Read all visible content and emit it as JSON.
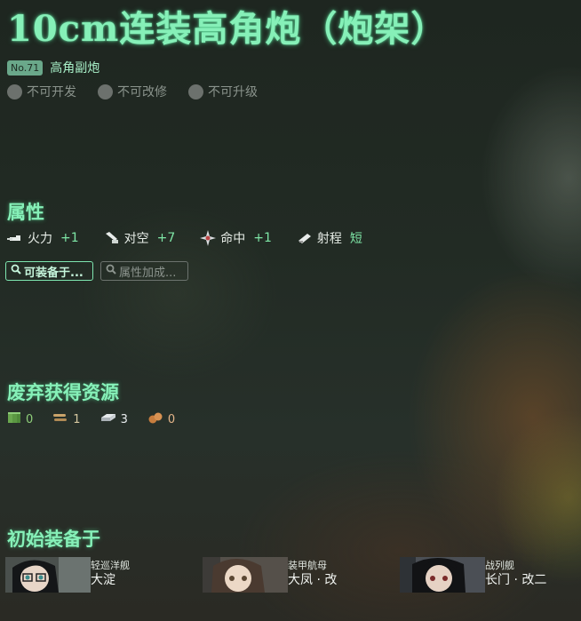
{
  "equipment": {
    "name": "10cm连装高角炮（炮架）",
    "number_badge": "No.71",
    "type": "高角副炮"
  },
  "flags": [
    {
      "label": "不可开发"
    },
    {
      "label": "不可改修"
    },
    {
      "label": "不可升级"
    }
  ],
  "stats_section": {
    "title": "属性",
    "items": [
      {
        "icon": "firepower-icon",
        "label": "火力",
        "value": "+1"
      },
      {
        "icon": "anti-air-icon",
        "label": "对空",
        "value": "+7"
      },
      {
        "icon": "accuracy-icon",
        "label": "命中",
        "value": "+1"
      },
      {
        "icon": "range-icon",
        "label": "射程",
        "value": "短"
      }
    ]
  },
  "buttons": {
    "equippable": "可装备于...",
    "bonus": "属性加成..."
  },
  "scrap_section": {
    "title": "废弃获得资源",
    "items": [
      {
        "icon": "fuel-icon",
        "value": "0"
      },
      {
        "icon": "ammo-icon",
        "value": "1"
      },
      {
        "icon": "steel-icon",
        "value": "3"
      },
      {
        "icon": "bauxite-icon",
        "value": "0"
      }
    ]
  },
  "initial_section": {
    "title": "初始装备于",
    "ships": [
      {
        "class": "轻巡洋舰",
        "name": "大淀"
      },
      {
        "class": "装甲航母",
        "name": "大凤 · 改"
      },
      {
        "class": "战列舰",
        "name": "长门 · 改二"
      }
    ]
  },
  "colors": {
    "accent": "#86f0b8",
    "stat_value": "#7ee6a6",
    "disabled": "#6c716d"
  }
}
